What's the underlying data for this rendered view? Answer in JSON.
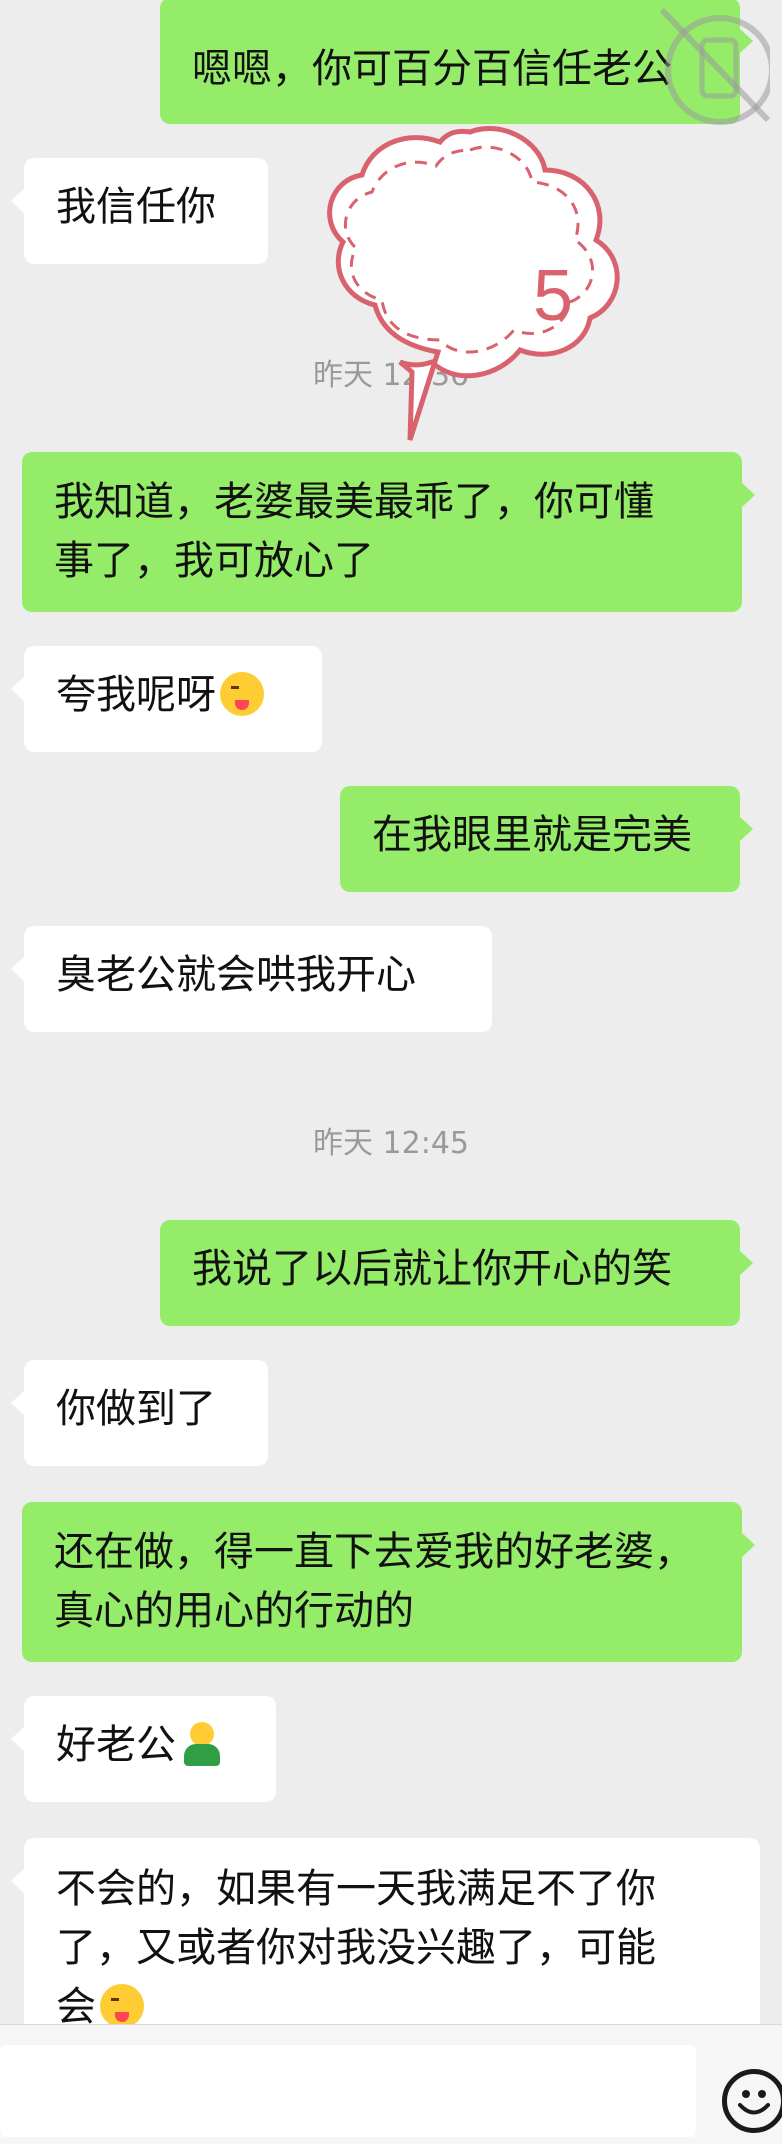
{
  "messages": [
    {
      "text": "嗯嗯，你可百分百信任老公"
    },
    {
      "text": "我信任你"
    },
    {
      "line1": "我知道，老婆最美最乖了，你可懂",
      "line2": "事了，我可放心了"
    },
    {
      "text": "夸我呢呀"
    },
    {
      "text": "在我眼里就是完美"
    },
    {
      "text": "臭老公就会哄我开心"
    },
    {
      "text": "我说了以后就让你开心的笑"
    },
    {
      "text": "你做到了"
    },
    {
      "line1": "还在做，得一直下去爱我的好老婆，",
      "line2": "真心的用心的行动的"
    },
    {
      "text": "好老公"
    },
    {
      "line1": "不会的，如果有一天我满足不了你",
      "line2": "了，又或者你对我没兴趣了，可能",
      "line3": "会"
    }
  ],
  "timestamps": [
    "昨天 12:36",
    "昨天 12:45"
  ],
  "badge": {
    "number": "5"
  },
  "icons": {
    "wink_emoji": "wink-tongue-emoji",
    "person_emoji": "person-emoji",
    "input_emoji": "smiley-icon",
    "watermark": "no-phone-watermark-icon"
  },
  "colors": {
    "outgoing": "#95ec69",
    "incoming": "#ffffff",
    "background": "#ededed",
    "badge": "#d9626f"
  }
}
